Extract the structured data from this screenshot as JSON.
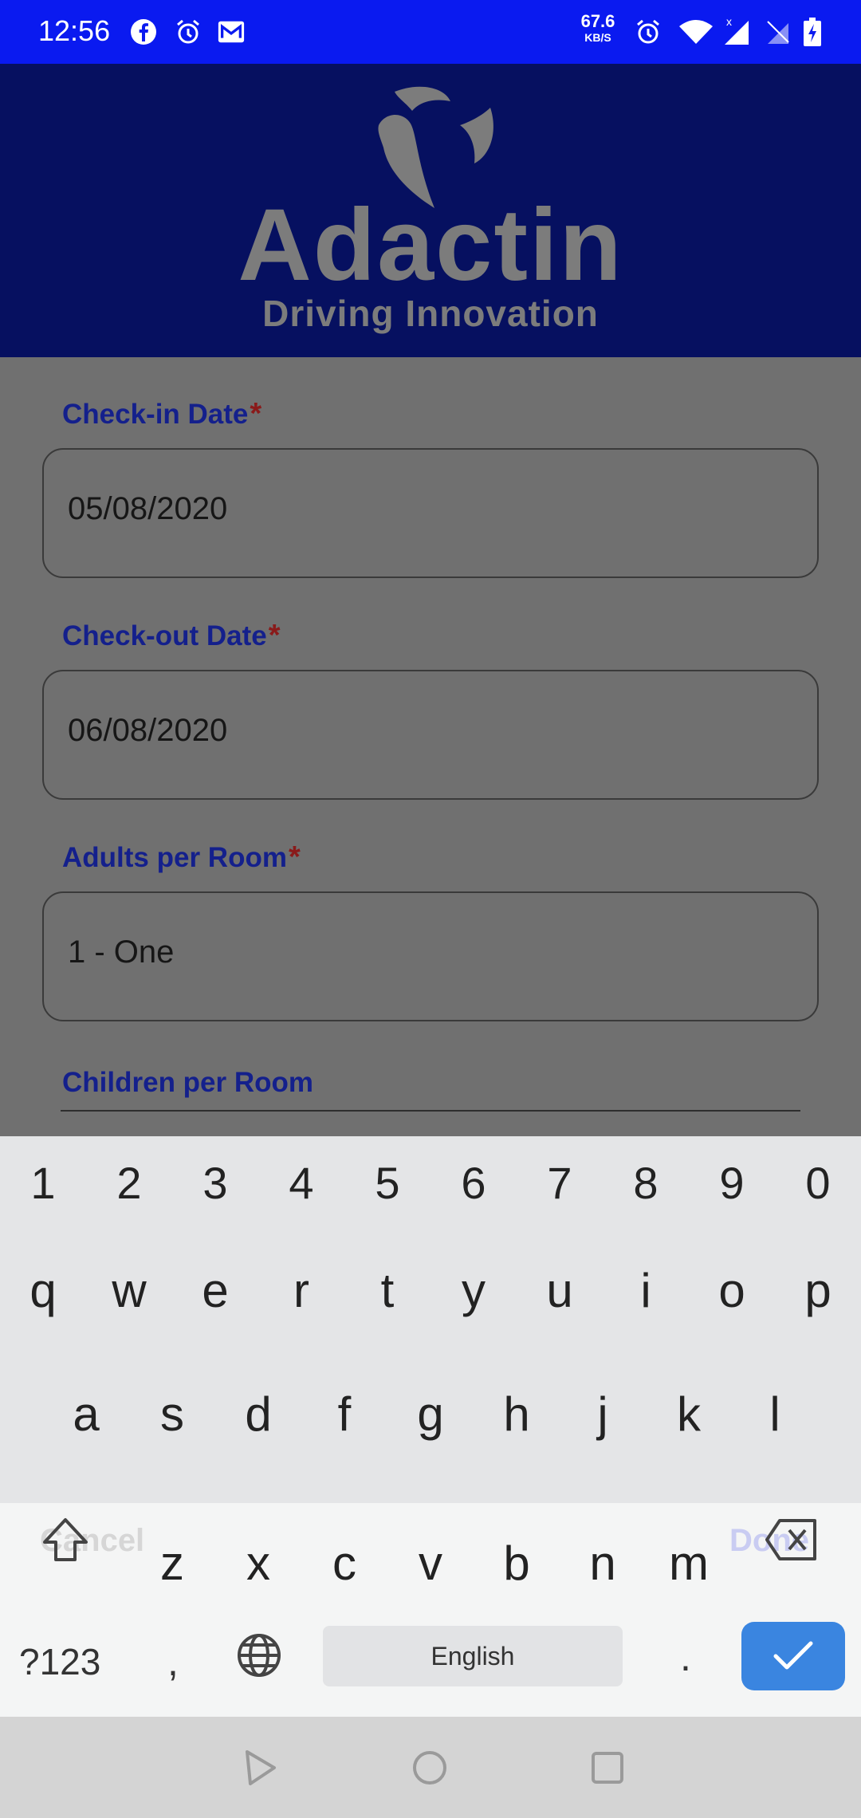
{
  "status_bar": {
    "time": "12:56",
    "net_speed_value": "67.6",
    "net_speed_unit": "KB/S",
    "icons": [
      "facebook-icon",
      "alarm-icon",
      "gmail-icon",
      "alarm-icon",
      "wifi-icon",
      "signal-icon",
      "no-sim-icon",
      "battery-charging-icon"
    ]
  },
  "header": {
    "brand_name": "Adactin",
    "tagline": "Driving Innovation"
  },
  "form": {
    "checkin": {
      "label": "Check-in Date",
      "required_mark": "*",
      "value": "05/08/2020"
    },
    "checkout": {
      "label": "Check-out Date",
      "required_mark": "*",
      "value": "06/08/2020"
    },
    "adults": {
      "label": "Adults per Room",
      "required_mark": "*",
      "value": "1 - One"
    },
    "children": {
      "label": "Children per Room"
    }
  },
  "picker": {
    "cancel_label": "Cancel",
    "done_label": "Done"
  },
  "keyboard": {
    "numbers": [
      "1",
      "2",
      "3",
      "4",
      "5",
      "6",
      "7",
      "8",
      "9",
      "0"
    ],
    "row1": [
      "q",
      "w",
      "e",
      "r",
      "t",
      "y",
      "u",
      "i",
      "o",
      "p"
    ],
    "row2": [
      "a",
      "s",
      "d",
      "f",
      "g",
      "h",
      "j",
      "k",
      "l"
    ],
    "row3": [
      "z",
      "x",
      "c",
      "v",
      "b",
      "n",
      "m"
    ],
    "symbols_label": "?123",
    "comma": ",",
    "space_label": "English",
    "period": "."
  },
  "colors": {
    "status_bar": "#0a1af0",
    "header": "#061060",
    "label": "#14208c",
    "enter_key": "#3a85e0"
  }
}
